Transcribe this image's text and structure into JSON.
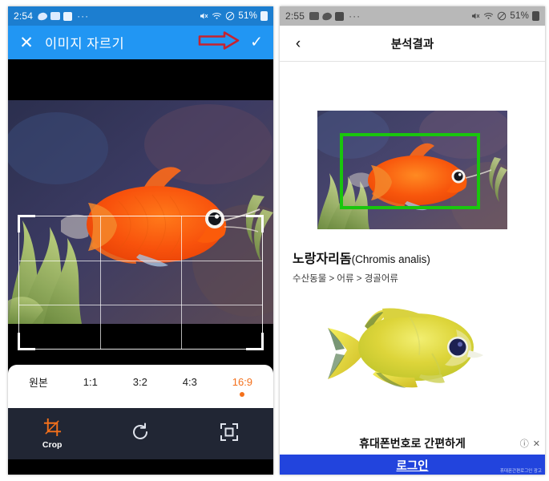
{
  "left_phone": {
    "status": {
      "time": "2:54",
      "icons": [
        "lens-icon",
        "photo-icon",
        "app-icon",
        "overflow-dots"
      ],
      "right_icons": [
        "mute-icon",
        "wifi-icon",
        "do-not-disturb-icon"
      ],
      "battery": "51%",
      "battery_icon": "battery-icon"
    },
    "header": {
      "close_icon": "✕",
      "title": "이미지 자르기",
      "confirm_icon": "✓",
      "annotation": "red-arrow-annotation"
    },
    "ratios": [
      {
        "label": "원본",
        "selected": false
      },
      {
        "label": "1:1",
        "selected": false
      },
      {
        "label": "3:2",
        "selected": false
      },
      {
        "label": "4:3",
        "selected": false
      },
      {
        "label": "16:9",
        "selected": true
      }
    ],
    "tools": [
      {
        "label": "Crop",
        "icon": "crop-icon",
        "active": true
      },
      {
        "label": "",
        "icon": "rotate-icon",
        "active": false
      },
      {
        "label": "",
        "icon": "fit-frame-icon",
        "active": false
      }
    ],
    "accent_color": "#f4701b",
    "header_color": "#2196f3"
  },
  "right_phone": {
    "status": {
      "time": "2:55",
      "icons": [
        "photo-icon",
        "lens-icon",
        "app-icon",
        "overflow-dots"
      ],
      "right_icons": [
        "mute-icon",
        "wifi-icon",
        "do-not-disturb-icon"
      ],
      "battery": "51%",
      "battery_icon": "battery-icon"
    },
    "header": {
      "back_icon": "‹",
      "title": "분석결과"
    },
    "result": {
      "detection_box_color": "#19c60d",
      "name_ko": "노랑자리돔",
      "name_sci": "(Chromis analis)",
      "taxonomy": "수산동물 > 어류 > 경골어류"
    },
    "ad": {
      "headline": "휴대폰번호로 간편하게",
      "button_label": "로그인",
      "advertiser_note": "휴대폰간편로그인 광고",
      "info_icon": "ⓘ",
      "close_icon": "✕",
      "button_color": "#2244dd"
    }
  }
}
